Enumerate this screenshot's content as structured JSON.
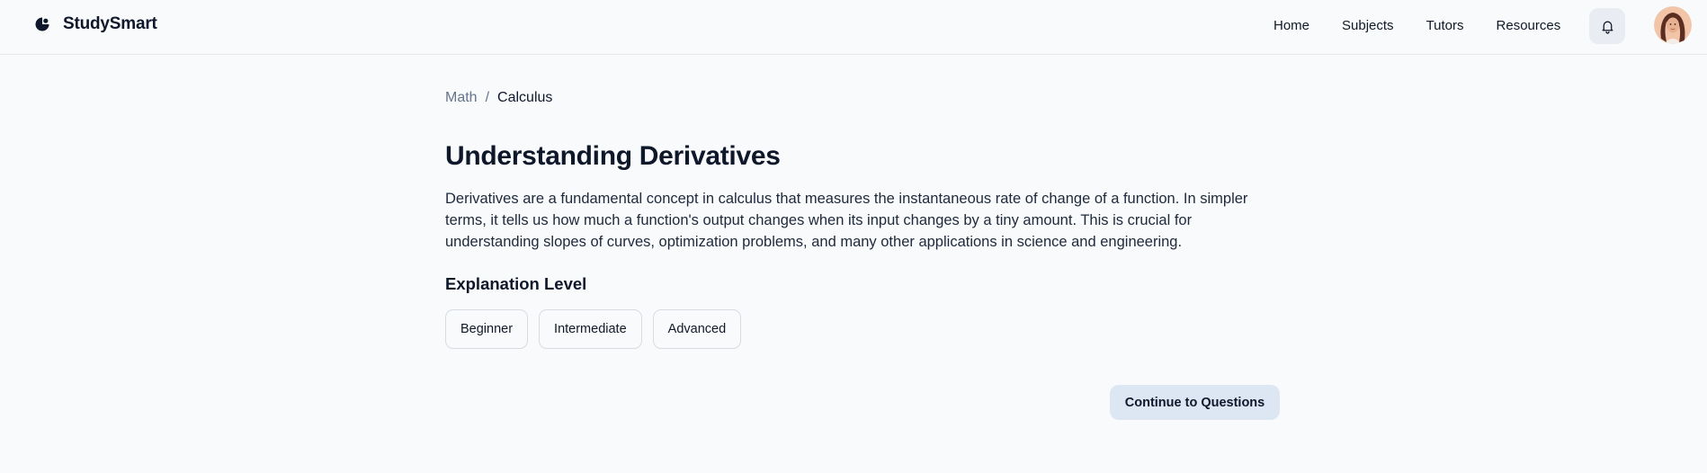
{
  "header": {
    "brand_name": "StudySmart",
    "brand_icon": "study-smart-logo",
    "nav": [
      {
        "label": "Home"
      },
      {
        "label": "Subjects"
      },
      {
        "label": "Tutors"
      },
      {
        "label": "Resources"
      }
    ],
    "notifications_icon": "bell-icon",
    "avatar": "user-avatar"
  },
  "breadcrumb": {
    "parent": "Math",
    "separator": "/",
    "current": "Calculus"
  },
  "main": {
    "title": "Understanding Derivatives",
    "description": "Derivatives are a fundamental concept in calculus that measures the instantaneous rate of change of a function. In simpler terms, it tells us how much a function's output changes when its input changes by a tiny amount. This is crucial for understanding slopes of curves, optimization problems, and many other applications in science and engineering.",
    "level_heading": "Explanation Level",
    "levels": [
      {
        "label": "Beginner"
      },
      {
        "label": "Intermediate"
      },
      {
        "label": "Advanced"
      }
    ],
    "continue_label": "Continue to Questions"
  },
  "colors": {
    "background": "#f8fafc",
    "text": "#0f172a",
    "muted": "#64748b",
    "primary_soft": "#dde7f3",
    "border": "#d7dce3"
  }
}
